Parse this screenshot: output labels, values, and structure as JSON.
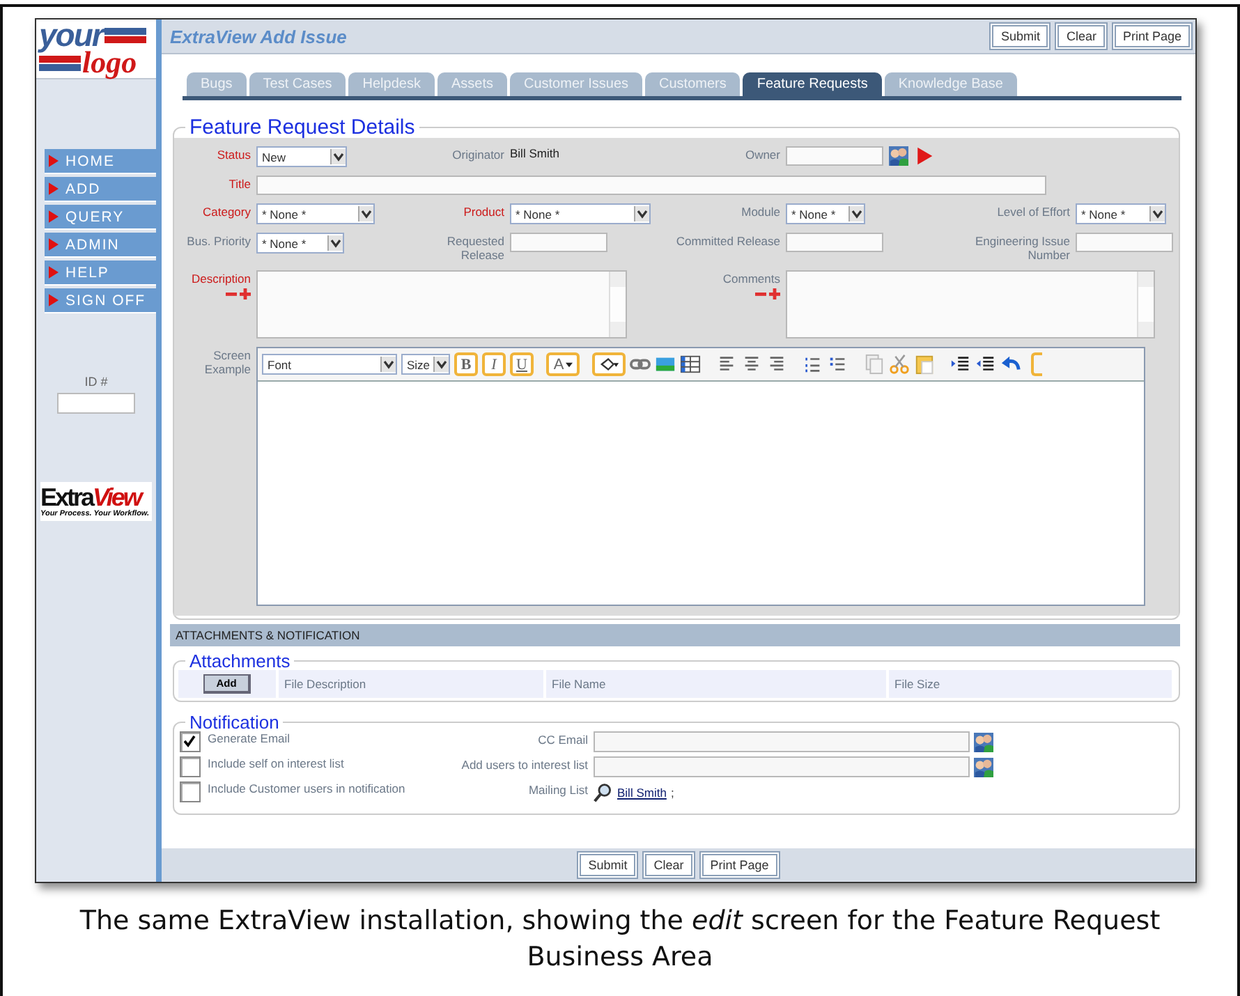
{
  "window": {
    "title": "ExtraView Add Issue"
  },
  "top_buttons": [
    "Submit",
    "Clear",
    "Print Page"
  ],
  "logo": {
    "line_1": "your",
    "line_2": "logo"
  },
  "nav": [
    {
      "label": "HOME"
    },
    {
      "label": "ADD"
    },
    {
      "label": "QUERY"
    },
    {
      "label": "ADMIN"
    },
    {
      "label": "HELP"
    },
    {
      "label": "SIGN OFF"
    }
  ],
  "id_field": {
    "label": "ID #"
  },
  "vendor_logo": {
    "name_1": "Extra",
    "name_2": "View",
    "tagline": "Your Process. Your Workflow."
  },
  "tabs": [
    {
      "label": "Bugs",
      "selected": false
    },
    {
      "label": "Test Cases",
      "selected": false
    },
    {
      "label": "Helpdesk",
      "selected": false
    },
    {
      "label": "Assets",
      "selected": false
    },
    {
      "label": "Customer Issues",
      "selected": false
    },
    {
      "label": "Customers",
      "selected": false
    },
    {
      "label": "Feature Requests",
      "selected": true
    },
    {
      "label": "Knowledge Base",
      "selected": false
    }
  ],
  "details": {
    "title": "Feature Request Details",
    "fields": [
      {
        "label": "Status",
        "required": true,
        "kind": "select",
        "value": "New"
      },
      {
        "label": "Originator",
        "required": false,
        "kind": "static",
        "value": "Bill Smith"
      },
      {
        "label": "Owner",
        "required": false,
        "kind": "user"
      },
      {
        "label": "Title",
        "required": true,
        "kind": "text"
      },
      {
        "label": "Category",
        "required": true,
        "kind": "select",
        "value": "* None *"
      },
      {
        "label": "Product",
        "required": true,
        "kind": "select",
        "value": "* None *"
      },
      {
        "label": "Module",
        "required": false,
        "kind": "select",
        "value": "* None *"
      },
      {
        "label": "Level of Effort",
        "required": false,
        "kind": "select",
        "value": "* None *"
      },
      {
        "label": "Bus. Priority",
        "required": false,
        "kind": "select",
        "value": "* None *"
      },
      {
        "label": "Requested Release",
        "required": false,
        "kind": "text"
      },
      {
        "label": "Committed Release",
        "required": false,
        "kind": "text"
      },
      {
        "label": "Engineering Issue Number",
        "required": false,
        "kind": "text"
      },
      {
        "label": "Description",
        "required": true,
        "kind": "textarea"
      },
      {
        "label": "Comments",
        "required": false,
        "kind": "textarea"
      },
      {
        "label": "Screen Example",
        "required": false,
        "kind": "editor"
      }
    ]
  },
  "editor_toolbar": [
    {
      "kind": "font",
      "value": "Font"
    },
    {
      "kind": "size",
      "value": "Size"
    },
    {
      "kind": "bold",
      "value": "B"
    },
    {
      "kind": "italic",
      "value": "I"
    },
    {
      "kind": "underline",
      "value": "U"
    },
    {
      "kind": "color",
      "value": "A"
    }
  ],
  "section_bar": "ATTACHMENTS & NOTIFICATION",
  "attachments": {
    "title": "Attachments",
    "add_button": "Add",
    "columns": [
      "File Description",
      "File Name",
      "File Size"
    ]
  },
  "notification": {
    "title": "Notification",
    "options": [
      {
        "label": "Generate Email",
        "checked": true
      },
      {
        "label": "Include self on interest list",
        "checked": false
      },
      {
        "label": "Include Customer users in notification",
        "checked": false
      }
    ],
    "fields": [
      {
        "label": "CC Email",
        "kind": "users"
      },
      {
        "label": "Add users to interest list",
        "kind": "users"
      },
      {
        "label": "Mailing List",
        "kind": "mailing",
        "link": "Bill Smith",
        "suffix": ";"
      }
    ]
  },
  "bottom_buttons": [
    "Submit",
    "Clear",
    "Print Page"
  ],
  "caption": "The same ExtraView installation, showing the *edit* screen for the Feature Request Business Area"
}
